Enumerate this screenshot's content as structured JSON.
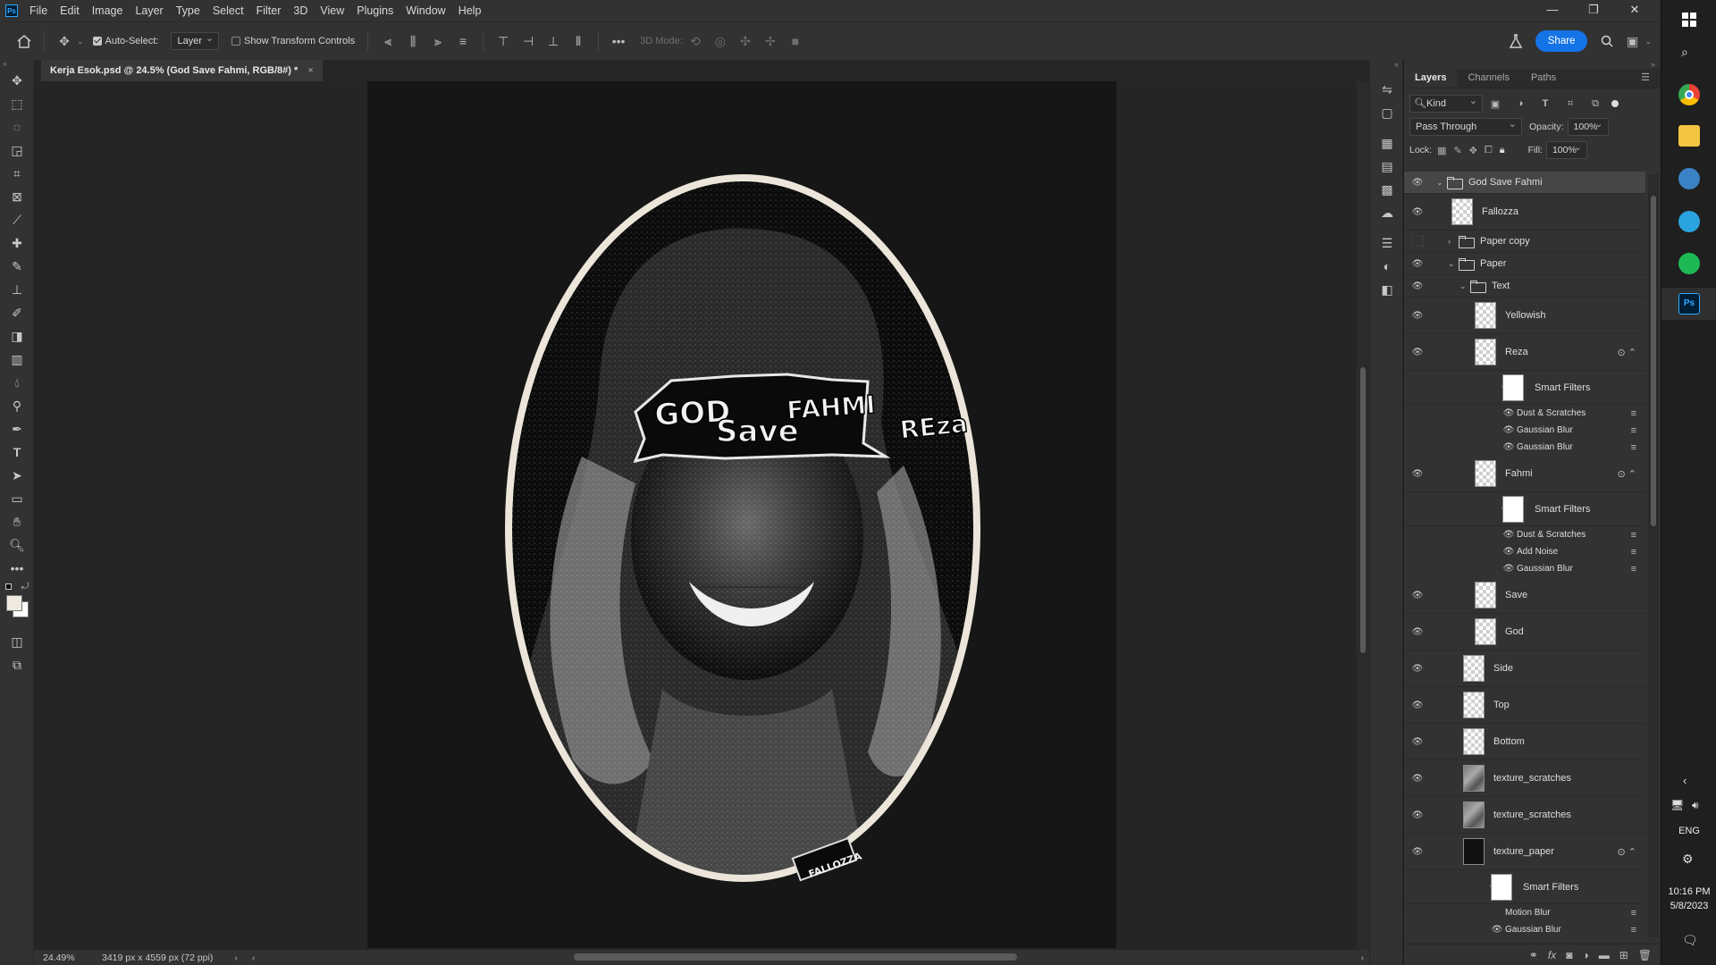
{
  "menubar": {
    "items": [
      "File",
      "Edit",
      "Image",
      "Layer",
      "Type",
      "Select",
      "Filter",
      "3D",
      "View",
      "Plugins",
      "Window",
      "Help"
    ]
  },
  "window_controls": {
    "minimize": "—",
    "restore": "❐",
    "close": "✕"
  },
  "options": {
    "auto_select_label": "Auto-Select:",
    "auto_select_target": "Layer",
    "show_transform_label": "Show Transform Controls",
    "mode_3d_label": "3D Mode:",
    "share_label": "Share"
  },
  "document": {
    "tab_title": "Kerja Esok.psd @ 24.5% (God Save Fahmi, RGB/8#) *",
    "close": "×"
  },
  "artwork": {
    "ransom_words": [
      "GOD",
      "Save",
      "FAHMI",
      "REza"
    ],
    "signature": "FALLOZZA"
  },
  "status": {
    "zoom": "24.49%",
    "doc_info": "3419 px x 4559 px (72 ppi)"
  },
  "panel": {
    "tabs": [
      "Layers",
      "Channels",
      "Paths"
    ],
    "filter_kind": "Kind",
    "blend_mode": "Pass Through",
    "opacity_label": "Opacity:",
    "opacity_value": "100%",
    "lock_label": "Lock:",
    "fill_label": "Fill:",
    "fill_value": "100%",
    "layers": [
      {
        "name": "God Save Fahmi",
        "kind": "group",
        "selected": true,
        "visible": true
      },
      {
        "name": "Fallozza",
        "kind": "layer",
        "visible": true
      },
      {
        "name": "Paper copy",
        "kind": "group",
        "visible": false
      },
      {
        "name": "Paper",
        "kind": "group",
        "visible": true
      },
      {
        "name": "Text",
        "kind": "group",
        "visible": true
      },
      {
        "name": "Yellowish",
        "kind": "layer",
        "visible": true
      },
      {
        "name": "Reza",
        "kind": "smart",
        "visible": true
      },
      {
        "name": "Smart Filters",
        "kind": "filters",
        "visible": true
      },
      {
        "name": "Dust & Scratches",
        "kind": "filter",
        "visible": true
      },
      {
        "name": "Gaussian Blur",
        "kind": "filter",
        "visible": true
      },
      {
        "name": "Gaussian Blur",
        "kind": "filter",
        "visible": true
      },
      {
        "name": "Fahmi",
        "kind": "smart",
        "visible": true
      },
      {
        "name": "Smart Filters",
        "kind": "filters",
        "visible": true
      },
      {
        "name": "Dust & Scratches",
        "kind": "filter",
        "visible": true
      },
      {
        "name": "Add Noise",
        "kind": "filter",
        "visible": true
      },
      {
        "name": "Gaussian Blur",
        "kind": "filter",
        "visible": true
      },
      {
        "name": "Save",
        "kind": "layer",
        "visible": true
      },
      {
        "name": "God",
        "kind": "layer",
        "visible": true
      },
      {
        "name": "Side",
        "kind": "layer",
        "visible": true
      },
      {
        "name": "Top",
        "kind": "layer",
        "visible": true
      },
      {
        "name": "Bottom",
        "kind": "layer",
        "visible": true
      },
      {
        "name": "texture_scratches",
        "kind": "texture",
        "visible": true
      },
      {
        "name": "texture_scratches",
        "kind": "texture",
        "visible": true
      },
      {
        "name": "texture_paper",
        "kind": "texture-smart",
        "visible": true
      },
      {
        "name": "Smart Filters",
        "kind": "filters",
        "visible": true
      },
      {
        "name": "Motion Blur",
        "kind": "filter",
        "visible": false
      },
      {
        "name": "Gaussian Blur",
        "kind": "filter",
        "visible": true
      }
    ]
  },
  "taskbar": {
    "language": "ENG",
    "time": "10:16 PM",
    "date": "5/8/2023"
  }
}
